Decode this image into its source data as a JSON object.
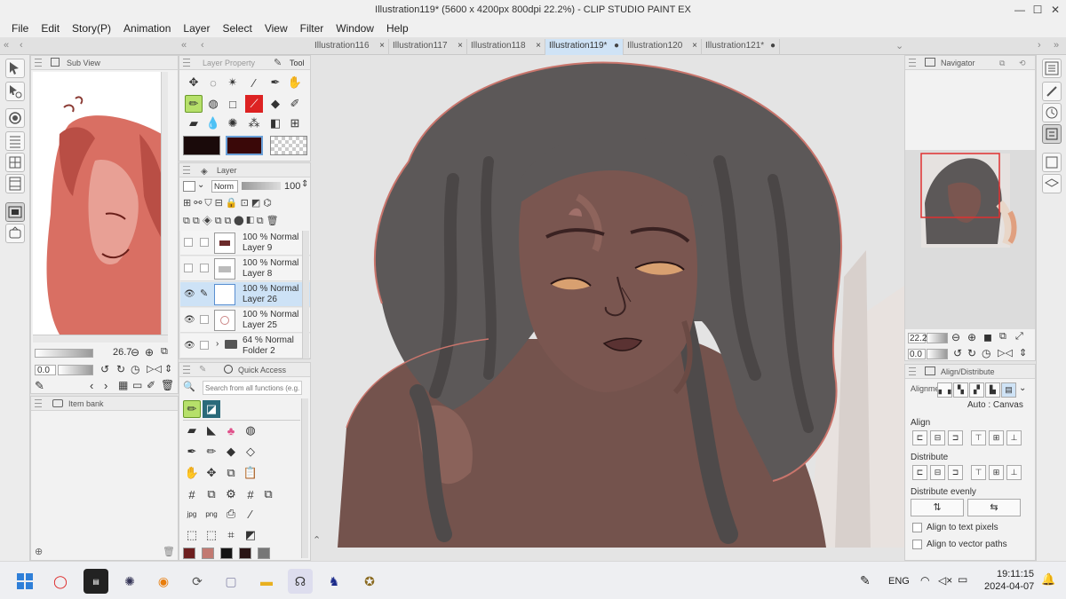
{
  "window": {
    "title": "Illustration119* (5600 x 4200px 800dpi 22.2%)  - CLIP STUDIO PAINT EX",
    "min_icon": "minimize-icon",
    "max_icon": "maximize-icon",
    "close_icon": "close-icon"
  },
  "menu": [
    "File",
    "Edit",
    "Story(P)",
    "Animation",
    "Layer",
    "Select",
    "View",
    "Filter",
    "Window",
    "Help"
  ],
  "tabs": [
    {
      "label": "Illustration116",
      "close": "×"
    },
    {
      "label": "Illustration117",
      "close": "×"
    },
    {
      "label": "Illustration118",
      "close": "×"
    },
    {
      "label": "Illustration119*",
      "close": "●",
      "active": true
    },
    {
      "label": "Illustration120",
      "close": "×"
    },
    {
      "label": "Illustration121*",
      "close": "●"
    }
  ],
  "subview": {
    "title": "Sub View",
    "zoom": "26.7",
    "rotation": "0.0"
  },
  "itembank": {
    "title": "Item bank"
  },
  "toolpanel": {
    "layer_property_tab": "Layer Property",
    "tool_tab": "Tool"
  },
  "colors": {
    "main": "#1a0a0a",
    "sub": "#3a0808",
    "accent_select": "#b6e06a",
    "active_tab": "#cfe3f6"
  },
  "layerpanel": {
    "title": "Layer",
    "blend_mode": "Norm",
    "opacity": "100",
    "layers": [
      {
        "opacity": "100 % Normal",
        "name": "Layer 9"
      },
      {
        "opacity": "100 % Normal",
        "name": "Layer 8"
      },
      {
        "opacity": "100 % Normal",
        "name": "Layer 26"
      },
      {
        "opacity": "100 % Normal",
        "name": "Layer 25"
      },
      {
        "opacity": "64 % Normal",
        "name": "Folder 2"
      }
    ]
  },
  "quickaccess": {
    "title": "Quick Access",
    "search_placeholder": "Search from all functions (e.g. br",
    "swatches": [
      "#6e1f1f",
      "#c27a72",
      "#141414",
      "#2a1414",
      "#777777"
    ]
  },
  "navigator": {
    "title": "Navigator",
    "zoom": "22.2",
    "rotation": "0.0"
  },
  "align": {
    "title": "Align/Distribute",
    "alignment_label": "Alignme",
    "auto_canvas": "Auto : Canvas",
    "align_label": "Align",
    "distribute_label": "Distribute",
    "distribute_evenly_label": "Distribute evenly",
    "text_pixels": "Align to text pixels",
    "vector_paths": "Align to vector paths"
  },
  "taskbar": {
    "lang": "ENG",
    "time": "19:11:15",
    "date": "2024-04-07"
  }
}
